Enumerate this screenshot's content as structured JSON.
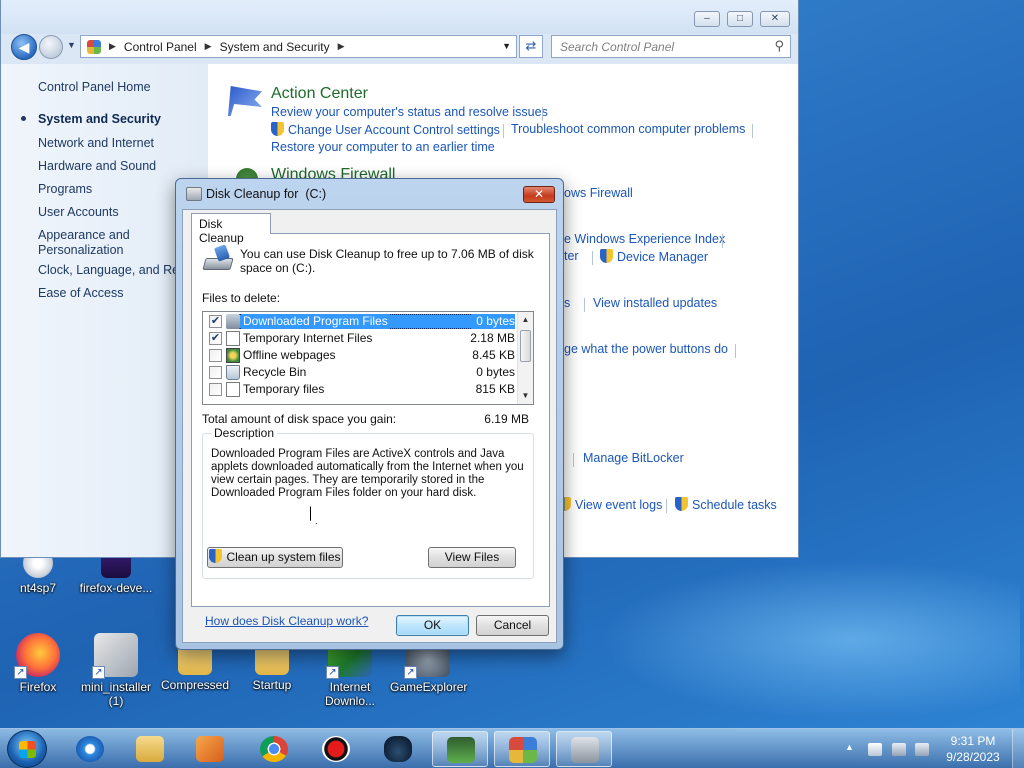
{
  "colors": {
    "desktop_blue": "#2a73c2",
    "link_blue": "#1b56b8",
    "heading_green": "#1f6a2b",
    "selection_blue": "#3399ff"
  },
  "desktop_icons": [
    {
      "label": "nt4sp7",
      "icon": "cd-installer-icon"
    },
    {
      "label": "firefox-deve...",
      "icon": "firefox-dev-icon"
    },
    {
      "label": "Firefox",
      "icon": "firefox-icon"
    },
    {
      "label": "mini_installer (1)",
      "icon": "installer-icon"
    },
    {
      "label": "Compressed",
      "icon": "folder-icon"
    },
    {
      "label": "Startup",
      "icon": "folder-icon"
    },
    {
      "label": "Internet Downlo...",
      "icon": "idm-icon"
    },
    {
      "label": "GameExplorer",
      "icon": "game-explorer-icon"
    }
  ],
  "control_panel": {
    "window_buttons": {
      "minimize": "‒",
      "maximize": "□",
      "close": "✕"
    },
    "breadcrumb": [
      "Control Panel",
      "System and Security"
    ],
    "search_placeholder": "Search Control Panel",
    "sidebar": {
      "home": "Control Panel Home",
      "items": [
        {
          "label": "System and Security",
          "active": true
        },
        {
          "label": "Network and Internet"
        },
        {
          "label": "Hardware and Sound"
        },
        {
          "label": "Programs"
        },
        {
          "label": "User Accounts"
        },
        {
          "label": "Appearance and Personalization"
        },
        {
          "label": "Clock, Language, and Reg"
        },
        {
          "label": "Ease of Access"
        }
      ]
    },
    "main": {
      "action_center": {
        "title": "Action Center",
        "links": [
          "Review your computer's status and resolve issues",
          "Change User Account Control settings",
          "Troubleshoot common computer problems",
          "Restore your computer to an earlier time"
        ]
      },
      "windows_firewall_title": "Windows Firewall",
      "partial_links": [
        "ows Firewall",
        "e Windows Experience Index",
        "ter",
        "Device Manager",
        "s",
        "View installed updates",
        "ge what the power buttons do",
        "Manage BitLocker",
        "View event logs",
        "Schedule tasks"
      ]
    }
  },
  "disk_cleanup": {
    "title": "Disk Cleanup for  (C:)",
    "close": "✕",
    "tab": "Disk Cleanup",
    "intro": "You can use Disk Cleanup to free up to 7.06 MB of disk space on  (C:).",
    "files_label": "Files to delete:",
    "files": [
      {
        "name": "Downloaded Program Files",
        "size": "0 bytes",
        "checked": true,
        "selected": true,
        "check": "✔"
      },
      {
        "name": "Temporary Internet Files",
        "size": "2.18 MB",
        "checked": true,
        "check": "✔"
      },
      {
        "name": "Offline webpages",
        "size": "8.45 KB",
        "checked": false,
        "check": ""
      },
      {
        "name": "Recycle Bin",
        "size": "0 bytes",
        "checked": false,
        "check": ""
      },
      {
        "name": "Temporary files",
        "size": "815 KB",
        "checked": false,
        "check": ""
      }
    ],
    "total_label": "Total amount of disk space you gain:",
    "total_value": "6.19 MB",
    "description_legend": "Description",
    "description": "Downloaded Program Files are ActiveX controls and Java applets downloaded automatically from the Internet when you view certain pages. They are temporarily stored in the Downloaded Program Files folder on your hard disk.",
    "cleanup_system_button": "Clean up system files",
    "view_files_button": "View Files",
    "help_link": "How does Disk Cleanup work?",
    "ok_button": "OK",
    "cancel_button": "Cancel"
  },
  "taskbar": {
    "pinned": [
      "internet-explorer-icon",
      "windows-explorer-icon",
      "media-player-icon",
      "chrome-icon",
      "recorder-icon",
      "game-controller-icon",
      "system-monitor-icon",
      "control-panel-icon",
      "disk-cleanup-icon"
    ],
    "time": "9:31 PM",
    "date": "9/28/2023",
    "tray_arrow": "▲"
  }
}
